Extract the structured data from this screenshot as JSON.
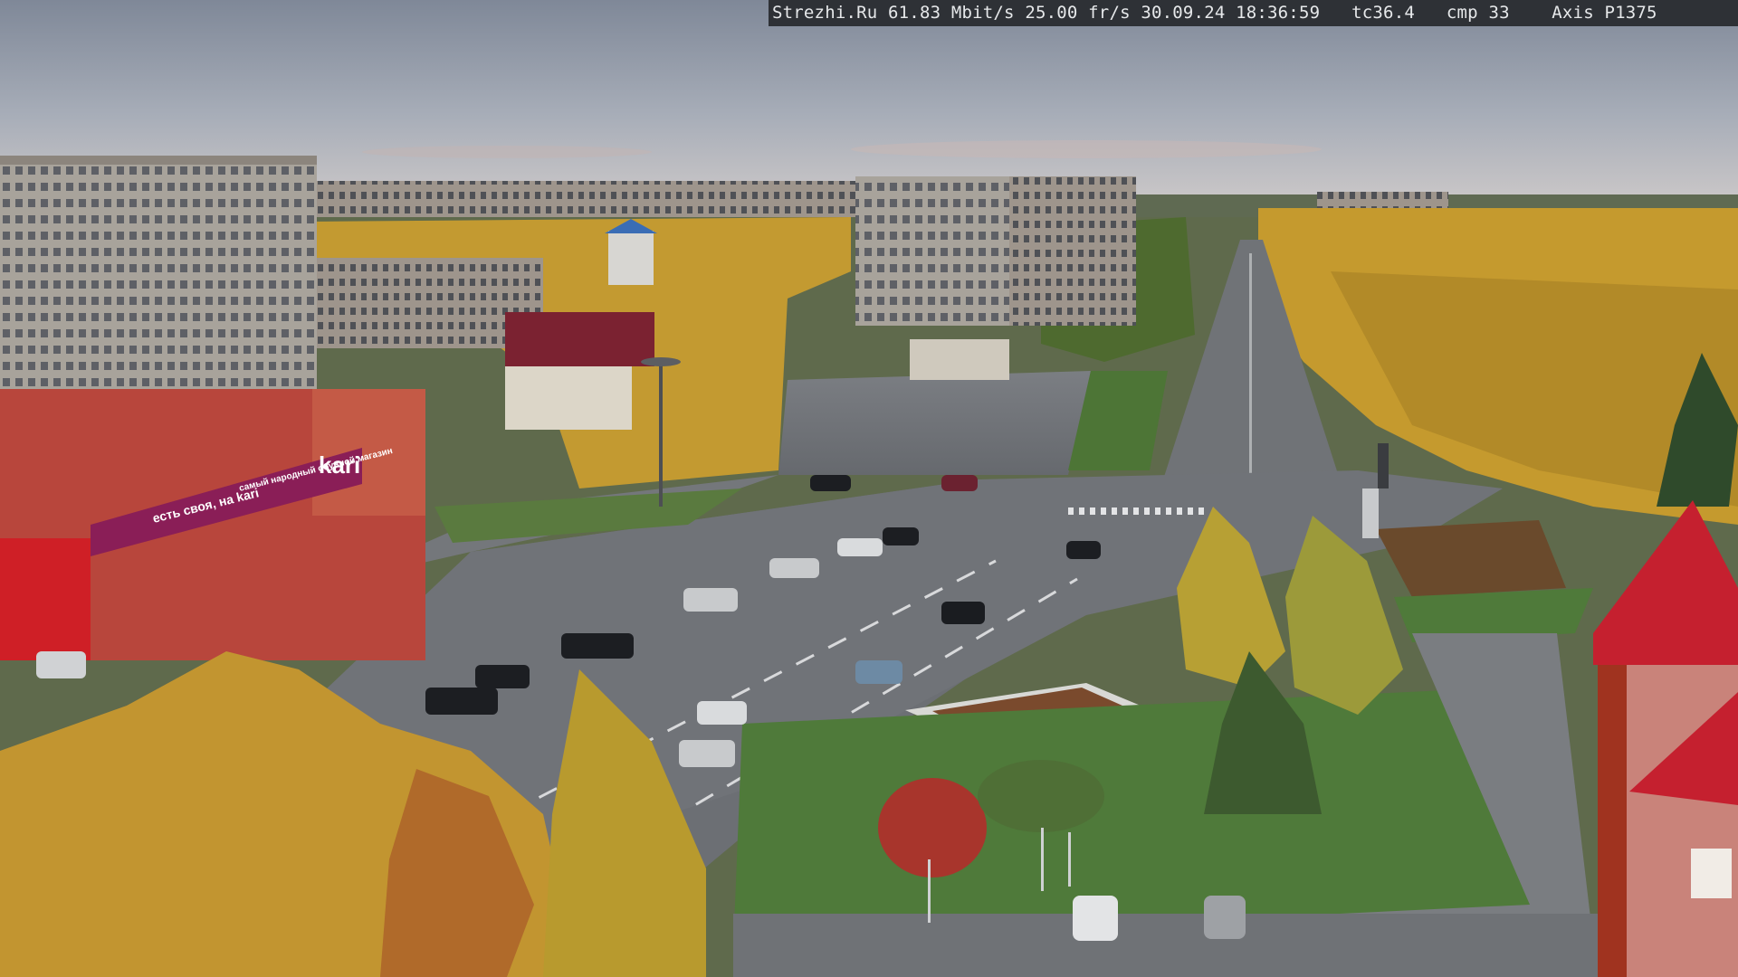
{
  "camera_overlay": {
    "text": "Strezhi.Ru 61.83 Mbit/s 25.00 fr/s 30.09.24 18:36:59   tc36.4   cmp 33    Axis P1375"
  },
  "storefront": {
    "brand_sign": "kari",
    "banner_text": "есть своя, на kari",
    "banner_text_2": "самый народный обувной магазин"
  },
  "colors": {
    "sky_top": "#8c94a3",
    "sky_bottom": "#c9ccd3",
    "foliage_yellow": "#c9a233",
    "building_red": "#b8463c",
    "store_magenta": "#8a1e57",
    "grass": "#4f7a3a",
    "asphalt": "#6e7176",
    "roof_red": "#c5202f"
  }
}
